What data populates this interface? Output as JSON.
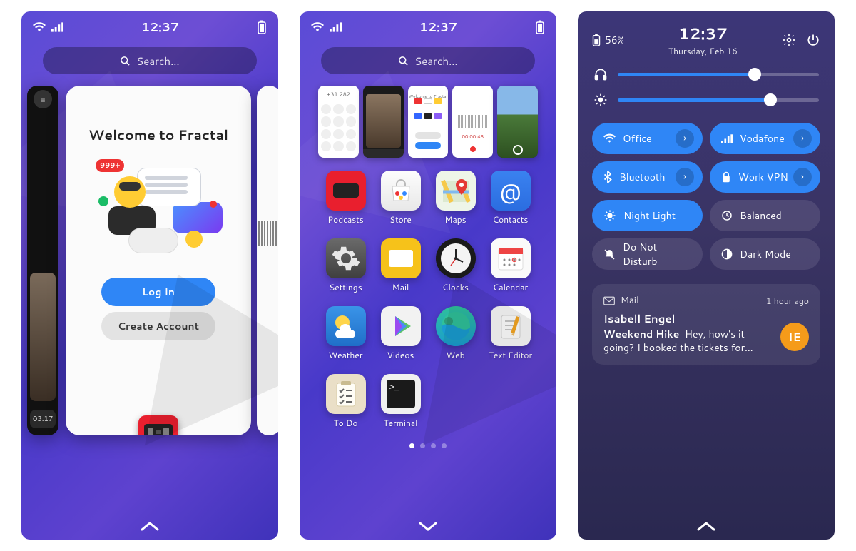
{
  "status": {
    "time": "12:37"
  },
  "search": {
    "placeholder": "Search…"
  },
  "phone1": {
    "card_title": "Welcome to Fractal",
    "badge": "999+",
    "login_btn": "Log In",
    "create_btn": "Create Account",
    "side_left_time": "03:17"
  },
  "phone2": {
    "recent_phone_number": "+31 282",
    "recent_fractal_title": "Welcome to Fractal",
    "recent_rec_time": "00:00:48",
    "apps": [
      {
        "label": "Podcasts",
        "tile": "podcasts"
      },
      {
        "label": "Store",
        "tile": "store"
      },
      {
        "label": "Maps",
        "tile": "maps"
      },
      {
        "label": "Contacts",
        "tile": "contacts"
      },
      {
        "label": "Settings",
        "tile": "settings"
      },
      {
        "label": "Mail",
        "tile": "mail"
      },
      {
        "label": "Clocks",
        "tile": "clocks"
      },
      {
        "label": "Calendar",
        "tile": "calendar"
      },
      {
        "label": "Weather",
        "tile": "weather"
      },
      {
        "label": "Videos",
        "tile": "videos"
      },
      {
        "label": "Web",
        "tile": "web"
      },
      {
        "label": "Text Editor",
        "tile": "editor"
      },
      {
        "label": "To Do",
        "tile": "todo"
      },
      {
        "label": "Terminal",
        "tile": "terminal"
      }
    ]
  },
  "phone3": {
    "battery": "56%",
    "time": "12:37",
    "date": "Thursday, Feb 16",
    "volume_pct": 68,
    "brightness_pct": 76,
    "toggles": [
      {
        "icon": "wifi",
        "label": "Office",
        "on": true,
        "more": true
      },
      {
        "icon": "signal",
        "label": "Vodafone",
        "on": true,
        "more": true
      },
      {
        "icon": "bluetooth",
        "label": "Bluetooth",
        "on": true,
        "more": true
      },
      {
        "icon": "lock",
        "label": "Work VPN",
        "on": true,
        "more": true
      },
      {
        "icon": "night",
        "label": "Night Light",
        "on": true,
        "more": false
      },
      {
        "icon": "power",
        "label": "Balanced",
        "on": false,
        "more": false
      },
      {
        "icon": "dnd",
        "label": "Do Not Disturb",
        "on": false,
        "more": false
      },
      {
        "icon": "dark",
        "label": "Dark Mode",
        "on": false,
        "more": false
      }
    ],
    "notif": {
      "app": "Mail",
      "time": "1 hour ago",
      "from": "Isabell Engel",
      "subject": "Weekend Hike",
      "body": "Hey, how's it going? I booked the tickets for…",
      "avatar": "IE"
    }
  }
}
